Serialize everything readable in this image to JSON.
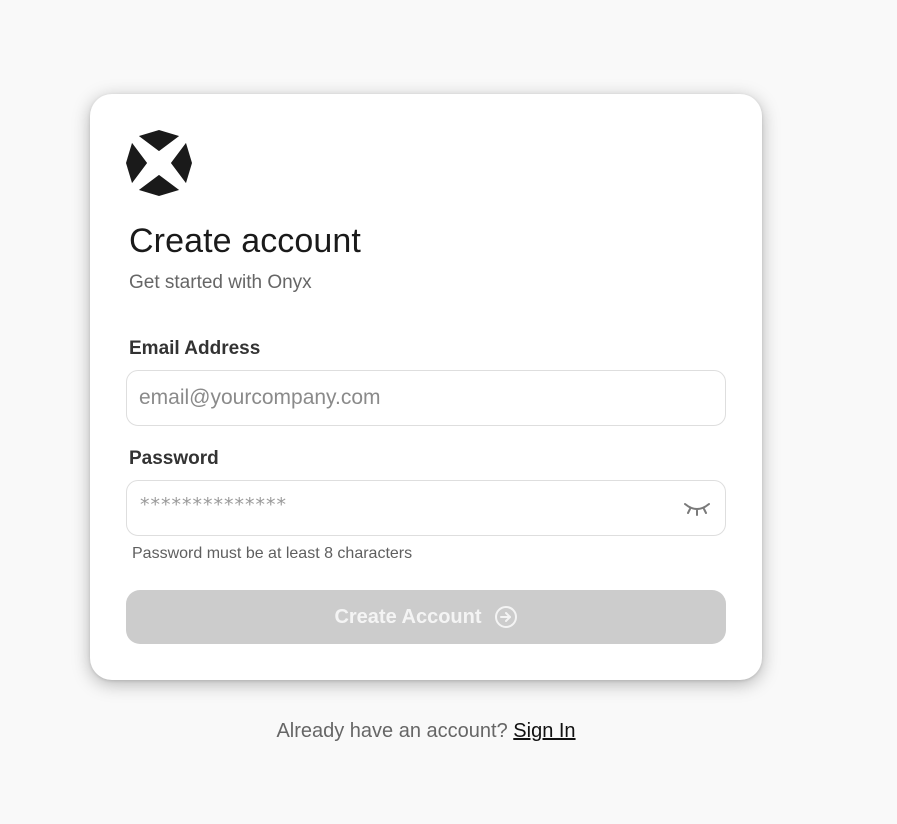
{
  "brand": {
    "logo_icon": "onyx-logo-icon",
    "name": "Onyx"
  },
  "form": {
    "title": "Create account",
    "subtitle": "Get started with Onyx",
    "email": {
      "label": "Email Address",
      "placeholder": "email@yourcompany.com",
      "value": ""
    },
    "password": {
      "label": "Password",
      "placeholder": "**************",
      "toggle_icon": "eye-closed-icon",
      "hint": "Password must be at least 8 characters"
    },
    "submit": {
      "label": "Create Account",
      "icon": "arrow-right-circle-icon",
      "disabled": true
    }
  },
  "footer": {
    "prompt": "Already have an account?",
    "link_label": "Sign In"
  },
  "colors": {
    "background": "#f9f9f9",
    "card": "#ffffff",
    "button_disabled": "#cccccc",
    "logo": "#1a1a1a"
  }
}
